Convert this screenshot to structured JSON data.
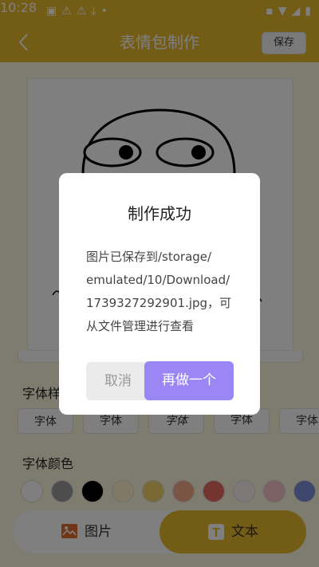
{
  "statusbar": {
    "time": "10:28"
  },
  "header": {
    "title": "表情包制作",
    "save_label": "保存"
  },
  "sections": {
    "font_style": "字体样式",
    "font_color": "字体颜色"
  },
  "font_chips": [
    "字体",
    "字体",
    "字体",
    "字体",
    "字体"
  ],
  "colors": [
    "#ffffff",
    "#9a9a9a",
    "#000000",
    "#fff2cc",
    "#f3d36a",
    "#f4a98a",
    "#e66a5f",
    "#fff0f2",
    "#f7c3c6",
    "#7d8fd6"
  ],
  "tabs": {
    "image_label": "图片",
    "text_label": "文本"
  },
  "dialog": {
    "title": "制作成功",
    "message_lines": [
      "图片已保存到/storage/",
      "emulated/10/Download/",
      "1739327292901.jpg，可",
      "从文件管理进行查看"
    ],
    "cancel_label": "取消",
    "confirm_label": "再做一个"
  },
  "accent_color": "#e6b92a",
  "button_color": "#9a86f5"
}
